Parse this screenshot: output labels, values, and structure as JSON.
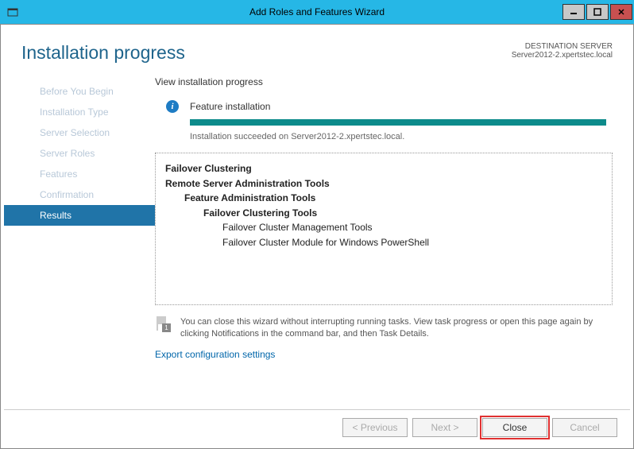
{
  "titlebar": {
    "title": "Add Roles and Features Wizard"
  },
  "header": {
    "page_title": "Installation progress",
    "dest_label": "DESTINATION SERVER",
    "dest_server": "Server2012-2.xpertstec.local"
  },
  "sidebar": {
    "items": [
      {
        "label": "Before You Begin"
      },
      {
        "label": "Installation Type"
      },
      {
        "label": "Server Selection"
      },
      {
        "label": "Server Roles"
      },
      {
        "label": "Features"
      },
      {
        "label": "Confirmation"
      },
      {
        "label": "Results"
      }
    ]
  },
  "main": {
    "sub_label": "View installation progress",
    "status_text": "Feature installation",
    "result_msg": "Installation succeeded on Server2012-2.xpertstec.local.",
    "features": {
      "l0a": "Failover Clustering",
      "l0b": "Remote Server Administration Tools",
      "l1": "Feature Administration Tools",
      "l2": "Failover Clustering Tools",
      "l3a": "Failover Cluster Management Tools",
      "l3b": "Failover Cluster Module for Windows PowerShell"
    },
    "note": "You can close this wizard without interrupting running tasks. View task progress or open this page again by clicking Notifications in the command bar, and then Task Details.",
    "export_link": "Export configuration settings",
    "flag_count": "1"
  },
  "footer": {
    "previous": "< Previous",
    "next": "Next >",
    "close": "Close",
    "cancel": "Cancel"
  }
}
